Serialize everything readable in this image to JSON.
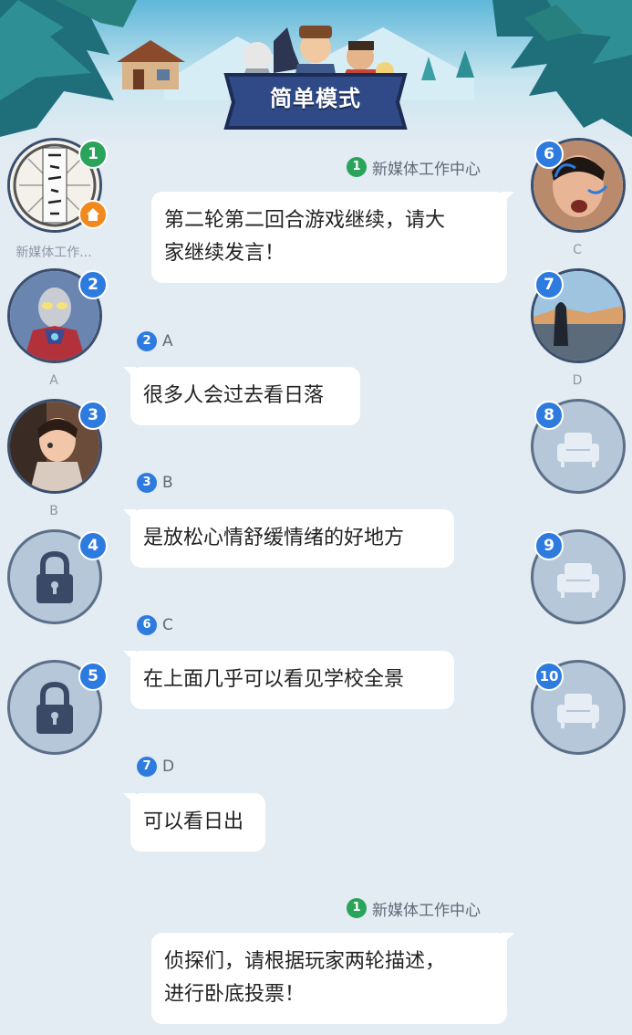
{
  "header": {
    "mode_label": "简单模式"
  },
  "seats": [
    {
      "number": "1",
      "name": "新媒体工作...",
      "avatar_icon": "calligraphy-avatar",
      "has_home_badge": true
    },
    {
      "number": "2",
      "name": "A",
      "avatar_icon": "ultraman-avatar"
    },
    {
      "number": "3",
      "name": "B",
      "avatar_icon": "girl-photo-avatar"
    },
    {
      "number": "4",
      "name": "",
      "avatar_icon": "lock-icon"
    },
    {
      "number": "5",
      "name": "",
      "avatar_icon": "lock-icon"
    },
    {
      "number": "6",
      "name": "C",
      "avatar_icon": "boy-photo-avatar"
    },
    {
      "number": "7",
      "name": "D",
      "avatar_icon": "landscape-photo-avatar"
    },
    {
      "number": "8",
      "name": "",
      "avatar_icon": "armchair-icon"
    },
    {
      "number": "9",
      "name": "",
      "avatar_icon": "armchair-icon"
    },
    {
      "number": "10",
      "name": "",
      "avatar_icon": "armchair-icon"
    }
  ],
  "messages": [
    {
      "seat": "1",
      "sender": "新媒体工作中心",
      "lines": [
        "第二轮第二回合游戏继续，请大",
        "家继续发言！"
      ],
      "side": "right"
    },
    {
      "seat": "2",
      "sender": "A",
      "lines": [
        "很多人会过去看日落"
      ],
      "side": "left"
    },
    {
      "seat": "3",
      "sender": "B",
      "lines": [
        "是放松心情舒缓情绪的好地方"
      ],
      "side": "left"
    },
    {
      "seat": "6",
      "sender": "C",
      "lines": [
        "在上面几乎可以看见学校全景"
      ],
      "side": "left"
    },
    {
      "seat": "7",
      "sender": "D",
      "lines": [
        "可以看日出"
      ],
      "side": "left"
    },
    {
      "seat": "1",
      "sender": "新媒体工作中心",
      "lines": [
        "侦探们，请根据玩家两轮描述，",
        "进行卧底投票！"
      ],
      "side": "right"
    }
  ],
  "colors": {
    "seat_badge": "#2e7be0",
    "host_badge": "#2aa45a",
    "home_badge": "#f08a1e",
    "background": "#e3ebf3"
  }
}
